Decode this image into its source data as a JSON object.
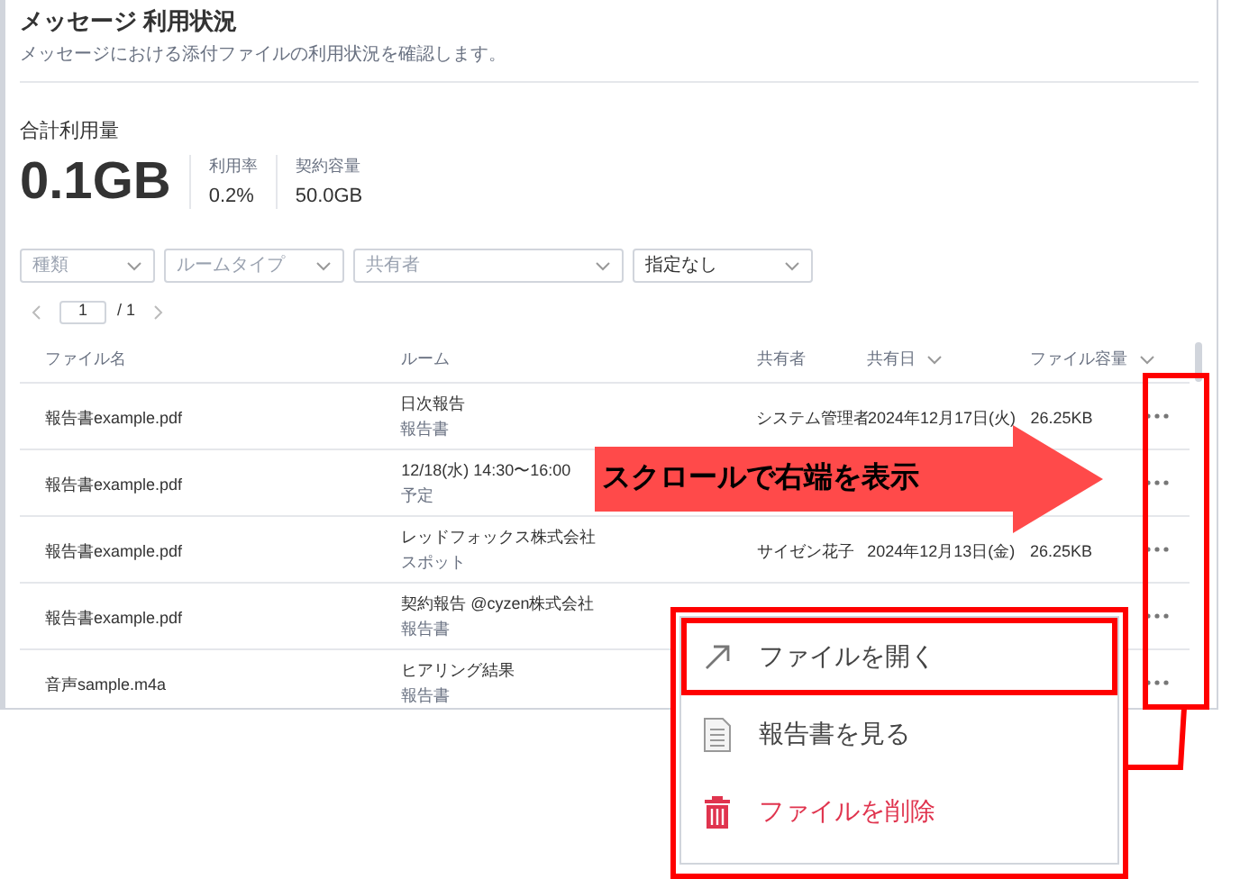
{
  "page": {
    "title": "メッセージ 利用状況",
    "description": "メッセージにおける添付ファイルの利用状況を確認します。"
  },
  "usage": {
    "label": "合計利用量",
    "total": "0.1GB",
    "stats": [
      {
        "label": "利用率",
        "value": "0.2%"
      },
      {
        "label": "契約容量",
        "value": "50.0GB"
      }
    ]
  },
  "filters": [
    {
      "placeholder": "種類"
    },
    {
      "placeholder": "ルームタイプ"
    },
    {
      "placeholder": "共有者"
    },
    {
      "value": "指定なし"
    }
  ],
  "pagination": {
    "page": "1",
    "total": "/ 1"
  },
  "table": {
    "columns": [
      {
        "label": "ファイル名",
        "sortable": false
      },
      {
        "label": "ルーム",
        "sortable": false
      },
      {
        "label": "共有者",
        "sortable": false
      },
      {
        "label": "共有日",
        "sortable": true
      },
      {
        "label": "ファイル容量",
        "sortable": true
      }
    ],
    "rows": [
      {
        "file": "報告書example.pdf",
        "room": "日次報告",
        "room_type": "報告書",
        "sharer": "システム管理者",
        "date": "2024年12月17日(火)",
        "size": "26.25KB"
      },
      {
        "file": "報告書example.pdf",
        "room": "12/18(水) 14:30〜16:00",
        "room_type": "予定"
      },
      {
        "file": "報告書example.pdf",
        "room": "レッドフォックス株式会社",
        "room_type": "スポット",
        "sharer": "サイゼン花子",
        "date": "2024年12月13日(金)",
        "size": "26.25KB"
      },
      {
        "file": "報告書example.pdf",
        "room": "契約報告 @cyzen株式会社",
        "room_type": "報告書"
      },
      {
        "file": "音声sample.m4a",
        "room": "ヒアリング結果",
        "room_type": "報告書"
      }
    ]
  },
  "menu": {
    "items": [
      {
        "kind": "open",
        "label": "ファイルを開く",
        "highlighted": true
      },
      {
        "kind": "view",
        "label": "報告書を見る",
        "highlighted": false
      },
      {
        "kind": "delete",
        "label": "ファイルを削除",
        "highlighted": false
      }
    ]
  },
  "annotation": {
    "arrow_text": "スクロールで右端を表示"
  }
}
